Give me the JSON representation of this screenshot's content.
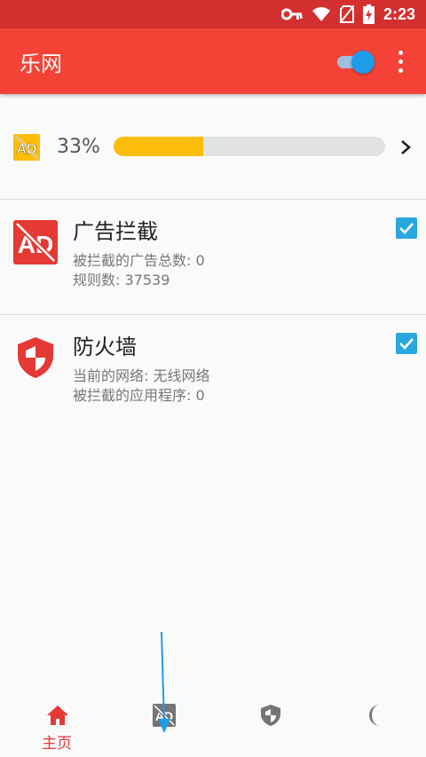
{
  "status_bar": {
    "time": "2:23",
    "icons": [
      "key-icon",
      "wifi-icon",
      "no-sim-icon",
      "battery-charging-icon"
    ]
  },
  "app_bar": {
    "title": "乐网",
    "toggle_on": true,
    "menu_icon": "more-vert-icon"
  },
  "progress": {
    "icon": "ad-block-icon",
    "percent_label": "33%",
    "value": 0.33,
    "chevron_icon": "chevron-right-icon"
  },
  "cards": [
    {
      "icon": "ad-block-icon",
      "title": "广告拦截",
      "line1": "被拦截的广告总数: 0",
      "line2": "规则数: 37539",
      "checked": true
    },
    {
      "icon": "shield-icon",
      "title": "防火墙",
      "line1": "当前的网络: 无线网络",
      "line2": "被拦截的应用程序: 0",
      "checked": true
    }
  ],
  "bottom_nav": [
    {
      "icon": "home-icon",
      "label": "主页",
      "active": true
    },
    {
      "icon": "ad-block-icon",
      "label": "",
      "active": false
    },
    {
      "icon": "shield-icon",
      "label": "",
      "active": false
    },
    {
      "icon": "moon-icon",
      "label": "",
      "active": false
    }
  ],
  "colors": {
    "status_bar": "#d32f2f",
    "app_bar": "#f44336",
    "accent_blue": "#1e9be9",
    "progress_fill": "#fbbd08",
    "checkbox": "#29a8e0",
    "active_nav": "#e53935",
    "inactive_nav": "#757575"
  }
}
